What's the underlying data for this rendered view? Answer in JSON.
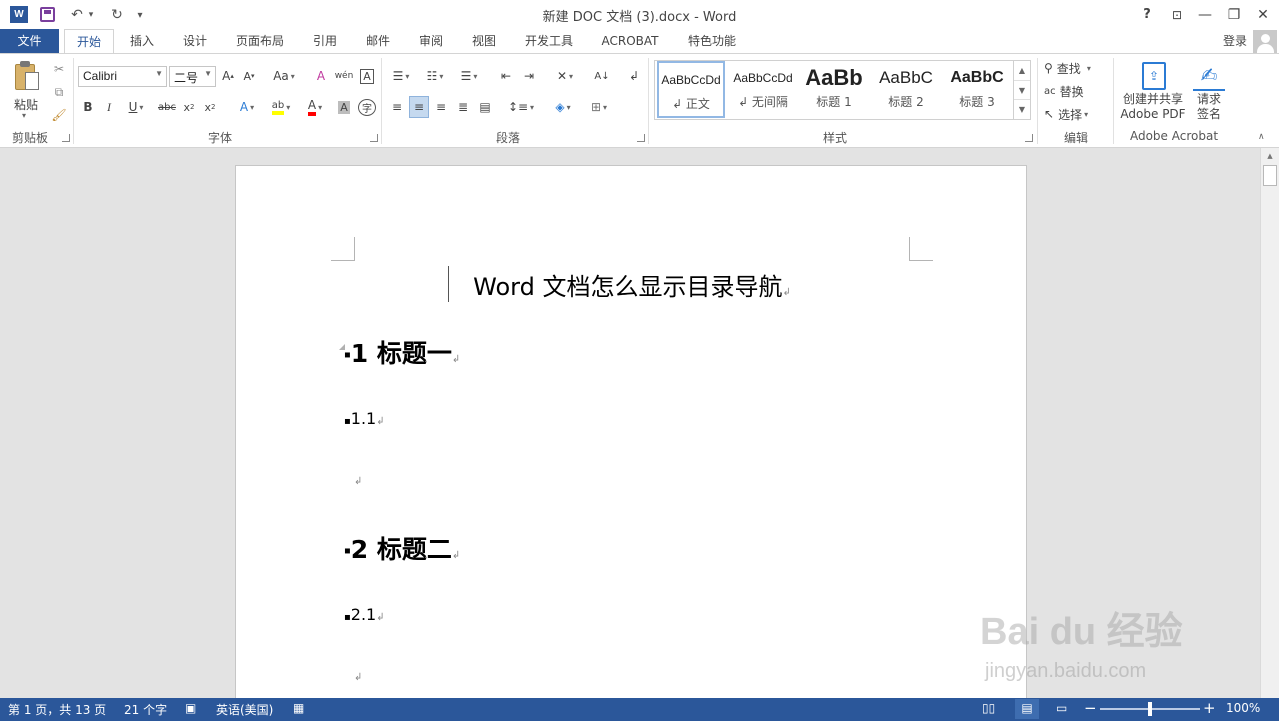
{
  "window": {
    "title": "新建 DOC 文档 (3).docx - Word",
    "help": "?",
    "minimize": "—",
    "restore": "❐",
    "close": "✕"
  },
  "quick_access": {
    "undo": "↶",
    "redo": "↻",
    "customize": "▾"
  },
  "tabs": [
    {
      "label": "文件"
    },
    {
      "label": "开始"
    },
    {
      "label": "插入"
    },
    {
      "label": "设计"
    },
    {
      "label": "页面布局"
    },
    {
      "label": "引用"
    },
    {
      "label": "邮件"
    },
    {
      "label": "审阅"
    },
    {
      "label": "视图"
    },
    {
      "label": "开发工具"
    },
    {
      "label": "ACROBAT"
    },
    {
      "label": "特色功能"
    }
  ],
  "account": {
    "signin": "登录"
  },
  "clipboard": {
    "paste": "粘贴",
    "group": "剪贴板"
  },
  "font": {
    "name": "Calibri",
    "size": "二号",
    "group": "字体"
  },
  "paragraph": {
    "group": "段落"
  },
  "styles": {
    "group": "样式",
    "items": [
      {
        "preview": "AaBbCcDd",
        "label": "↲ 正文"
      },
      {
        "preview": "AaBbCcDd",
        "label": "↲ 无间隔"
      },
      {
        "preview": "AaBb",
        "label": "标题 1"
      },
      {
        "preview": "AaBbC",
        "label": "标题 2"
      },
      {
        "preview": "AaBbC",
        "label": "标题 3"
      }
    ]
  },
  "editing": {
    "group": "编辑",
    "find": "查找",
    "replace": "替换",
    "select": "选择"
  },
  "acrobat": {
    "group": "Adobe Acrobat",
    "create_line1": "创建并共享",
    "create_line2": "Adobe PDF",
    "sign_line1": "请求",
    "sign_line2": "签名"
  },
  "document": {
    "title": "Word 文档怎么显示目录导航",
    "heading1": "1 标题一",
    "sub1": "1.1",
    "heading2": "2 标题二",
    "sub2": "2.1",
    "para_mark": "↲"
  },
  "status": {
    "page": "第 1 页，共 13 页",
    "words": "21 个字",
    "language": "英语(美国)",
    "zoom": "100%",
    "zoom_level": 1.0
  },
  "watermark": {
    "brand": "Bai du 经验",
    "url": "jingyan.baidu.com"
  },
  "colors": {
    "accent": "#2b579a",
    "highlight": "#ffff00",
    "font_color": "#ff0000"
  }
}
